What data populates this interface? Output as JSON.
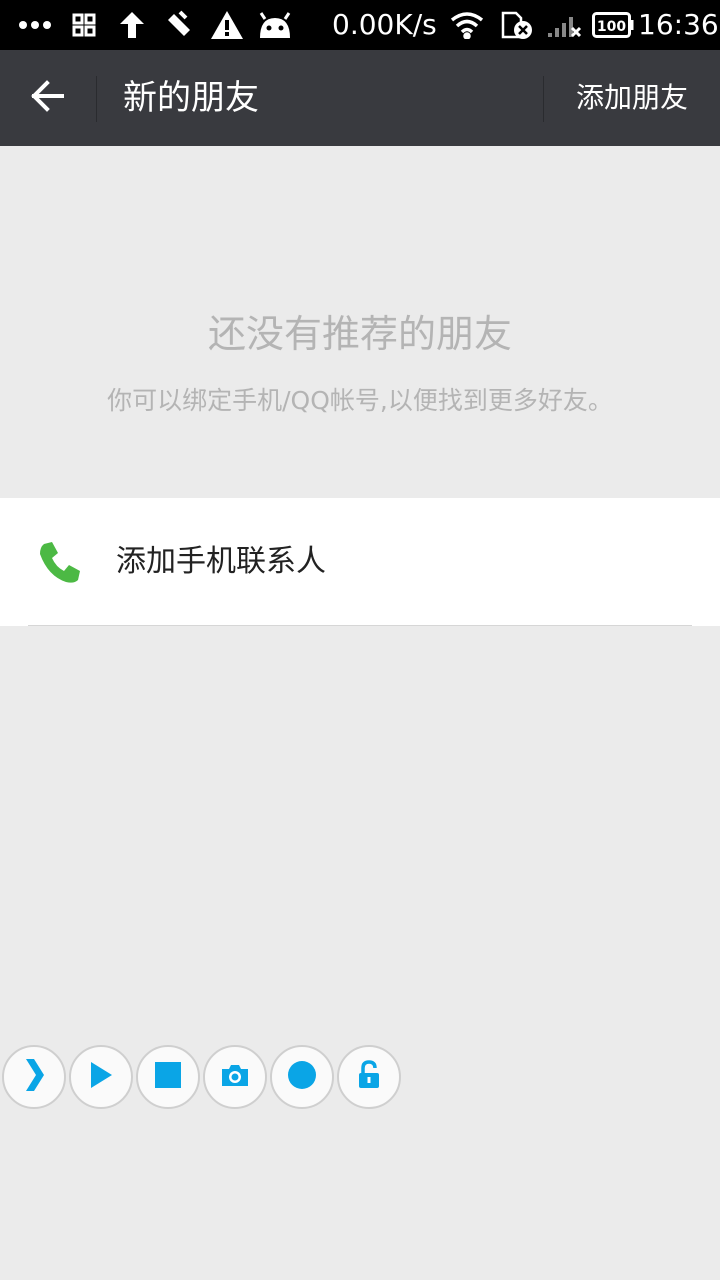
{
  "status_bar": {
    "net_speed": "0.00K/s",
    "battery": "100",
    "time": "16:36",
    "icons": [
      "more-dots-icon",
      "qr-grid-icon",
      "upload-arrow-icon",
      "signal-tool-icon",
      "warning-icon",
      "android-icon",
      "wifi-icon",
      "sim-error-icon",
      "cell-signal-icon",
      "battery-icon"
    ]
  },
  "header": {
    "title": "新的朋友",
    "action_label": "添加朋友",
    "back_icon": "back-arrow-icon"
  },
  "empty_state": {
    "title": "还没有推荐的朋友",
    "subtitle": "你可以绑定手机/QQ帐号,以便找到更多好友。"
  },
  "contacts_row": {
    "label": "添加手机联系人",
    "icon": "phone-icon",
    "icon_color": "#4cb944"
  },
  "toolbar": {
    "accent": "#0aa5e6",
    "buttons": [
      "expand-chevron-icon",
      "play-icon",
      "stop-icon",
      "camera-icon",
      "record-icon",
      "unlock-icon"
    ]
  },
  "colors": {
    "status_bar_bg": "#000000",
    "header_bg": "#393a3f",
    "page_bg": "#ebebeb",
    "hint_text": "#b4b4b4"
  }
}
